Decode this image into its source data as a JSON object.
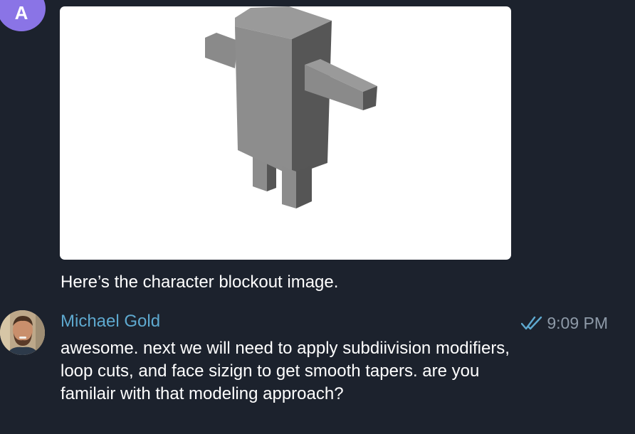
{
  "messages": [
    {
      "avatar_initial": "A",
      "avatar_color": "#8a74e6",
      "image": {
        "description_icon": "3d-character-blockout-image"
      },
      "caption": "Here’s the character blockout image."
    },
    {
      "sender": "Michael Gold",
      "sender_color": "#5ea9cf",
      "time": "9:09 PM",
      "status_icon": "double-check-icon",
      "text": "awesome. next we will need to apply subdiivision modifiers, loop cuts, and face sizign to get smooth tapers. are you familair with that modeling approach?"
    }
  ],
  "theme": {
    "background": "#1c222d",
    "accent": "#5ea9cf"
  }
}
